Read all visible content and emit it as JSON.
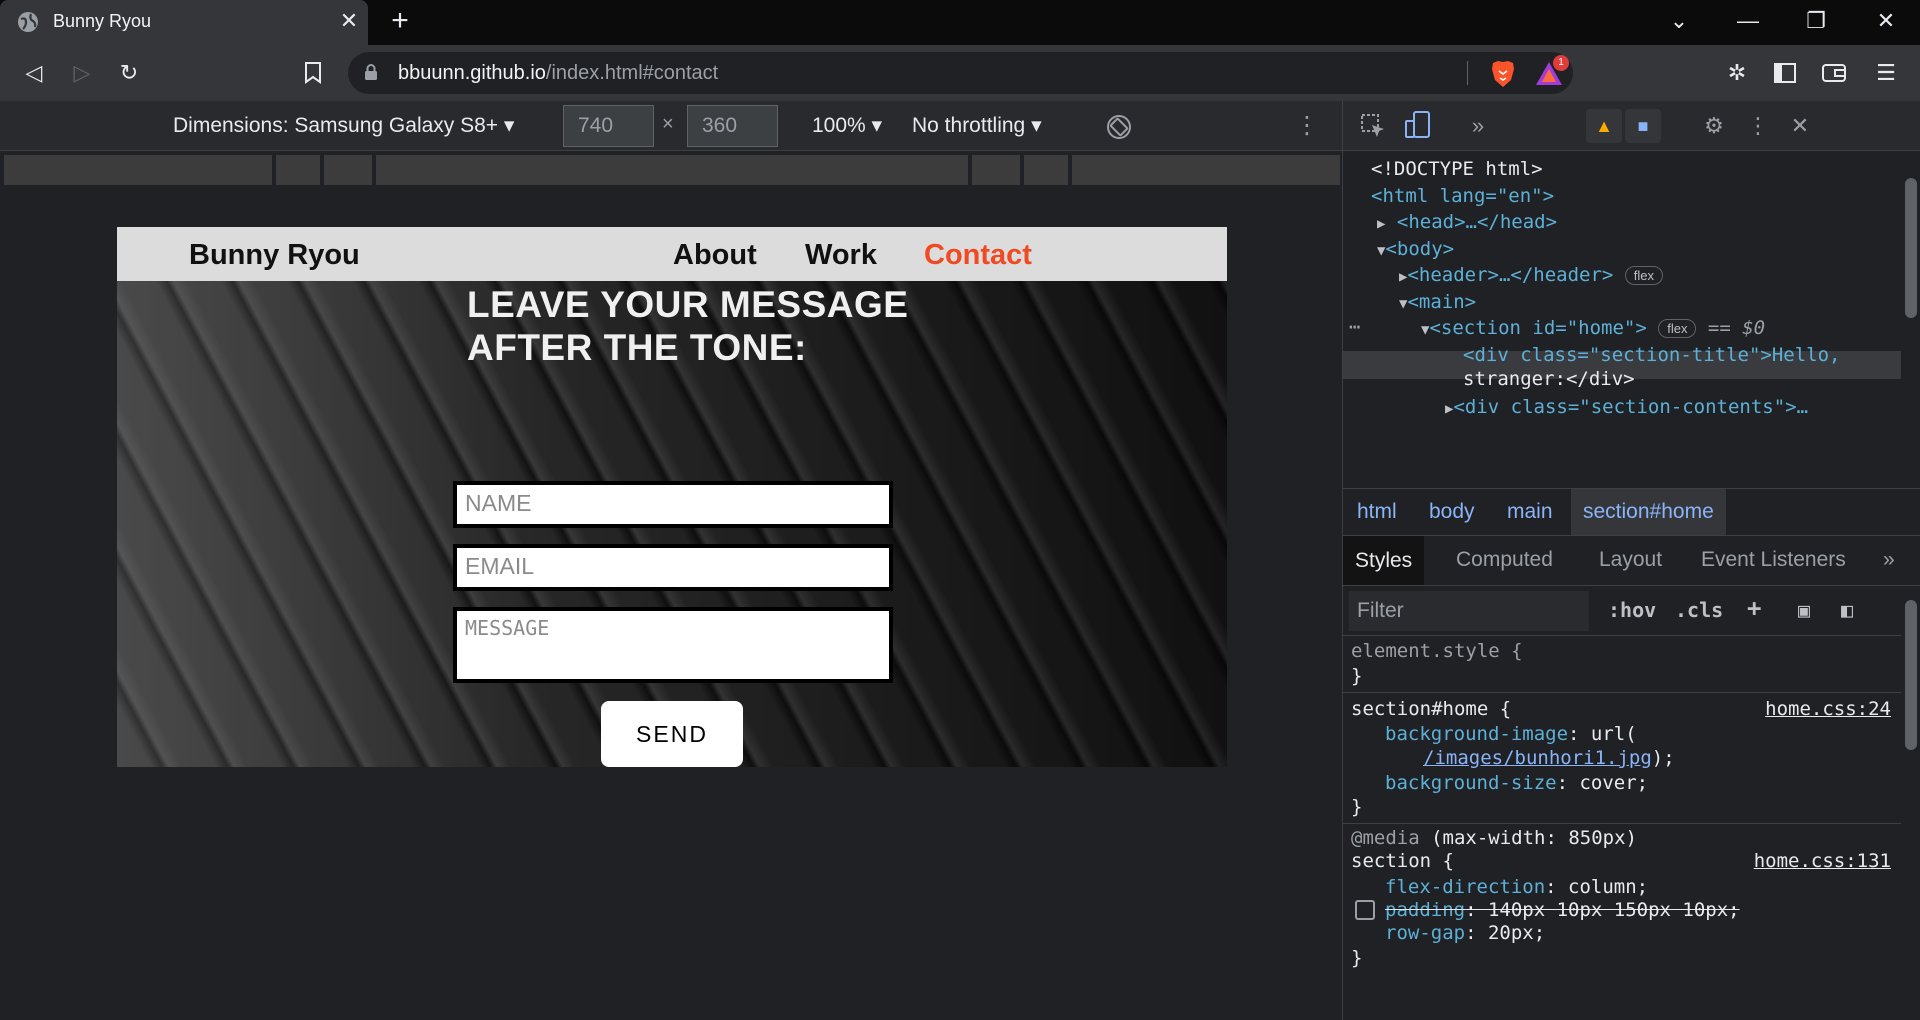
{
  "browser": {
    "tab_title": "Bunny Ryou",
    "url_host": "bbuunn.github.io",
    "url_path": "/index.html#contact",
    "rewards_count": "1"
  },
  "device_toolbar": {
    "dimensions_label": "Dimensions: Samsung Galaxy S8+",
    "width_value": "740",
    "height_value": "360",
    "times": "×",
    "zoom": "100%",
    "throttling": "No throttling"
  },
  "site": {
    "brand": "Bunny Ryou",
    "nav": [
      "About",
      "Work",
      "Contact"
    ],
    "active_nav": "Contact",
    "active_color": "#f04a23",
    "hero_title_lines": [
      "LEAVE YOUR MESSAGE",
      "AFTER THE TONE:"
    ],
    "name_placeholder": "NAME",
    "email_placeholder": "EMAIL",
    "message_placeholder": "MESSAGE",
    "send_label": "SEND"
  },
  "devtools": {
    "dom": {
      "doctype": "<!DOCTYPE html>",
      "html_open": "<html lang=\"en\">",
      "head": "<head>…</head>",
      "body_open": "<body>",
      "header": "<header>…</header>",
      "main_open": "<main>",
      "section_open": "<section id=\"home\">",
      "section_ref": "== $0",
      "div_title": "<div class=\"section-title\">Hello,",
      "div_title_cont": "stranger:</div>",
      "div_contents": "<div class=\"section-contents\">…",
      "flex_badge": "flex"
    },
    "breadcrumbs": [
      "html",
      "body",
      "main",
      "section#home"
    ],
    "tabs": [
      "Styles",
      "Computed",
      "Layout",
      "Event Listeners"
    ],
    "active_tab": "Styles",
    "filter_placeholder": "Filter",
    "hov": ":hov",
    "cls": ".cls",
    "styles": {
      "element_style": "element.style {",
      "close_brace": "}",
      "rule1_selector": "section#home {",
      "rule1_source": "home.css:24",
      "rule1_prop1": "background-image",
      "rule1_val1_prefix": "url(",
      "rule1_val1_link": "/images/bunhori1.jpg",
      "rule1_val1_suffix": ");",
      "rule1_prop2": "background-size",
      "rule1_val2": "cover;",
      "media_keyword": "@media",
      "media_query": "(max-width: 850px)",
      "rule2_selector": "section {",
      "rule2_source": "home.css:131",
      "rule2_prop1": "flex-direction",
      "rule2_val1": "column;",
      "rule2_prop2": "padding",
      "rule2_val2": "140px 10px 150px 10px;",
      "rule2_prop3": "row-gap",
      "rule2_val3": "20px;"
    }
  }
}
